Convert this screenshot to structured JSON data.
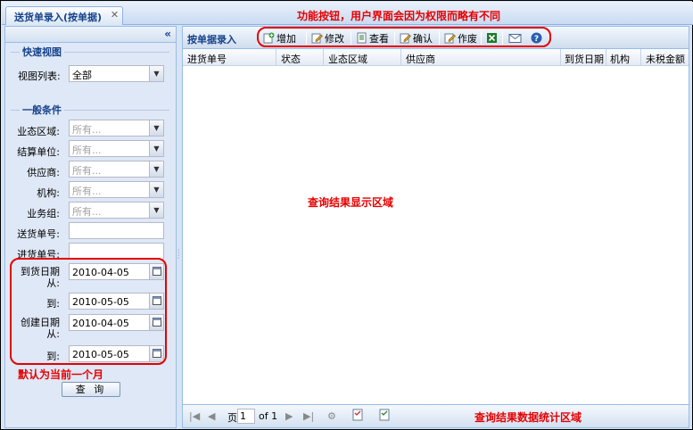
{
  "tab": {
    "title": "送货单录入(按单据)",
    "close_glyph": "✕"
  },
  "annotations": {
    "toolbar_note": "功能按钮，用户界面会因为权限而略有不同",
    "results_area": "查询结果显示区域",
    "default_month": "默认为当前一个月",
    "stats_area": "查询结果数据统计区域"
  },
  "left": {
    "collapse_glyph": "«",
    "quick_view": {
      "title": "快速视图",
      "label": "视图列表:",
      "value": "全部"
    },
    "general": {
      "title": "一般条件",
      "placeholder": "所有...",
      "combos": [
        {
          "label": "业态区域:"
        },
        {
          "label": "结算单位:"
        },
        {
          "label": "供应商:"
        },
        {
          "label": "机构:"
        },
        {
          "label": "业务组:"
        }
      ],
      "texts": [
        {
          "label": "送货单号:"
        },
        {
          "label": "进货单号:"
        }
      ],
      "dates": [
        {
          "label_1": "到货日期",
          "label_2": "从:",
          "value": "2010-04-05"
        },
        {
          "label_1": "到:",
          "value": "2010-05-05"
        },
        {
          "label_1": "创建日期",
          "label_2": "从:",
          "value": "2010-04-05"
        },
        {
          "label_1": "到:",
          "value": "2010-05-05"
        }
      ]
    },
    "query_button": "查 询"
  },
  "right": {
    "toolbar_title": "按单据录入",
    "buttons": [
      {
        "label": "增加",
        "icon": "add-icon"
      },
      {
        "label": "修改",
        "icon": "edit-icon"
      },
      {
        "label": "查看",
        "icon": "view-icon"
      },
      {
        "label": "确认",
        "icon": "confirm-icon"
      },
      {
        "label": "作废",
        "icon": "void-icon"
      },
      {
        "label": "",
        "icon": "excel-icon"
      },
      {
        "label": "",
        "icon": "mail-icon"
      },
      {
        "label": "",
        "icon": "help-icon"
      }
    ],
    "columns": [
      "进货单号",
      "状态",
      "业态区域",
      "供应商",
      "到货日期",
      "机构",
      "未税金额"
    ],
    "pager": {
      "page_prefix": "页",
      "page_value": "1",
      "page_suffix": "of 1"
    }
  },
  "colors": {
    "accent": "#15428b",
    "annotation": "#e60000",
    "panel_bg": "#dfe8f6"
  }
}
